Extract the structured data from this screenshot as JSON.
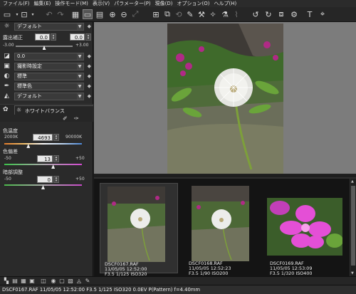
{
  "menu": {
    "items": [
      "ファイル(F)",
      "編集(E)",
      "操作モード(M)",
      "表示(V)",
      "パラメーター(P)",
      "現像(D)",
      "オプション(O)",
      "ヘルプ(H)"
    ]
  },
  "toolbar": {
    "icons": [
      "folder-icon",
      "open-image-icon",
      "undo-icon",
      "redo-icon",
      "view-thumbnails-icon",
      "view-preview-icon",
      "view-split-icon",
      "zoom-in-icon",
      "zoom-out-icon",
      "fit-icon",
      "rotate-icon",
      "rotate-right-icon",
      "tools-icon",
      "filter-icon",
      "brush-icon",
      "crop-icon",
      "develop-icon",
      "settings-icon",
      "text-tool-icon",
      "color-picker-icon"
    ]
  },
  "panel": {
    "preset_default": "デフォルト",
    "exposure_label": "露出補正",
    "exposure_value_a": "0.0",
    "exposure_value_b": "0.0",
    "exposure_min": "-3.00",
    "exposure_max": "+3.00",
    "exposure_level": 0.5,
    "tone_value": "0.0",
    "shooting_setting": "撮影時設定",
    "standard": "標準",
    "standard_color": "標準色",
    "default2": "デフォルト",
    "wb_tab": "ホワイトバランス",
    "temp_label": "色温度",
    "temp_min": "2000K",
    "temp_value": "4693",
    "temp_max": "90000K",
    "temp_level": 0.31,
    "tint_label": "色偏差",
    "tint_min": "-50",
    "tint_value": "13",
    "tint_max": "+50",
    "tint_level": 0.63,
    "dark_label": "暗部調整",
    "dark_min": "-50",
    "dark_value": "0",
    "dark_max": "+50",
    "dark_level": 0.5
  },
  "thumbnails": [
    {
      "name": "DSCF0167.RAF",
      "datetime": "11/05/05 12:52:00",
      "exposure": "F3.5 1/125 ISO320",
      "selected": true
    },
    {
      "name": "DSCF0168.RAF",
      "datetime": "11/05/05 12:52:23",
      "exposure": "F3.5 1/90 ISO200",
      "selected": false
    },
    {
      "name": "DSCF0169.RAF",
      "datetime": "11/05/05 12:53:09",
      "exposure": "F3.5 1/320 ISO400",
      "selected": false
    }
  ],
  "statusbar": {
    "text": "DSCF0167.RAF 11/05/05 12:52:00  F3.5 1/125 ISO320  0.0EV P(Pattern) f=4.40mm"
  },
  "colors": {
    "accent": "#4a90d9",
    "background": "#1e1e1e",
    "preview_gray": "#7c7c7c"
  }
}
